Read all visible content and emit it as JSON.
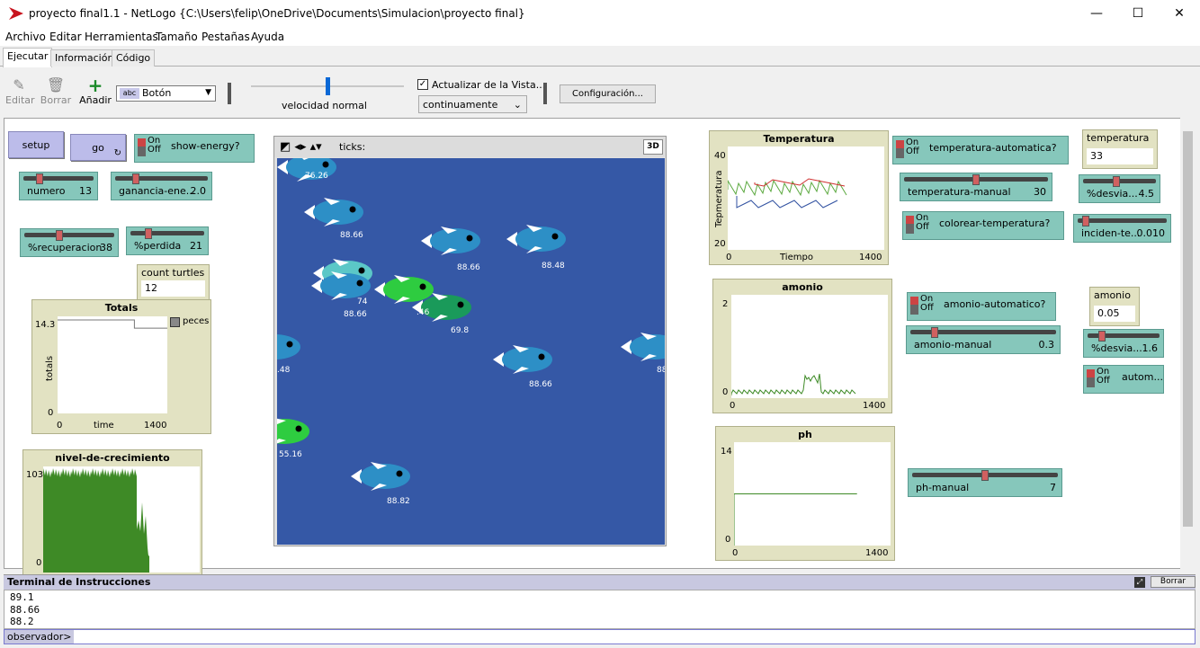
{
  "window": {
    "title": "proyecto final1.1 - NetLogo {C:\\Users\\felip\\OneDrive\\Documents\\Simulacion\\proyecto final}",
    "minimize": "—",
    "maximize": "☐",
    "close": "✕"
  },
  "menu": [
    "Archivo",
    "Editar",
    "Herramientas",
    "Tamaño",
    "Pestañas",
    "Ayuda"
  ],
  "tabs": [
    "Ejecutar",
    "Información",
    "Código"
  ],
  "toolbar": {
    "edit": "Editar",
    "delete": "Borrar",
    "add": "Añadir",
    "widget_type": "Botón",
    "widget_abc": "abc",
    "speed_label": "velocidad normal",
    "update_view_label": "Actualizar de la Vista...",
    "update_mode": "continuamente",
    "settings": "Configuración...",
    "speed_value": 0.5
  },
  "buttons": {
    "setup": "setup",
    "go": "go",
    "go_icon": "↻"
  },
  "switches": {
    "on": "On",
    "off": "Off",
    "show_energy": "show-energy?",
    "temp_auto": "temperatura-automatica?",
    "colorear_temp": "colorear-temperatura?",
    "amonio_auto": "amonio-automatico?",
    "autom": "autom..."
  },
  "sliders": {
    "numero": {
      "name": "numero",
      "value": "13",
      "pos": 0.2
    },
    "ganancia": {
      "name": "ganancia-ene...",
      "value": "2.0",
      "pos": 0.2
    },
    "recuperacion": {
      "name": "%recuperacion",
      "value": "38",
      "pos": 0.38
    },
    "perdida": {
      "name": "%perdida",
      "value": "21",
      "pos": 0.21
    },
    "temp_manual": {
      "name": "temperatura-manual",
      "value": "30",
      "pos": 0.5
    },
    "desvia1": {
      "name": "%desvia...",
      "value": "4.5",
      "pos": 0.45
    },
    "incidente": {
      "name": "inciden-te...",
      "value": "0.010",
      "pos": 0.05
    },
    "amonio_manual": {
      "name": "amonio-manual",
      "value": "0.3",
      "pos": 0.15
    },
    "desvia2": {
      "name": "%desvia...",
      "value": "1.6",
      "pos": 0.16
    },
    "ph_manual": {
      "name": "ph-manual",
      "value": "7",
      "pos": 0.5
    }
  },
  "monitors": {
    "count": {
      "label": "count turtles",
      "value": "12"
    },
    "temperatura": {
      "label": "temperatura",
      "value": "33"
    },
    "amonio": {
      "label": "amonio",
      "value": "0.05"
    }
  },
  "view": {
    "ticks_label": "ticks:",
    "three_d": "3D"
  },
  "fish": [
    {
      "label": "76.26"
    },
    {
      "label": "88.66"
    },
    {
      "label": "88.66"
    },
    {
      "label": "88.48"
    },
    {
      "label": "74"
    },
    {
      "label": "88.66"
    },
    {
      "label": "69.8"
    },
    {
      "label": ".46"
    },
    {
      "label": ".48"
    },
    {
      "label": "88.66"
    },
    {
      "label": "88"
    },
    {
      "label": "55.16"
    },
    {
      "label": "88.82"
    }
  ],
  "chart_data": [
    {
      "type": "line",
      "title": "Totals",
      "xlabel": "time",
      "ylabel": "totals",
      "x_ticks": [
        "0",
        "1400"
      ],
      "y_ticks": [
        "0",
        "14.3"
      ],
      "legend": "peces",
      "series": [
        {
          "name": "peces",
          "x": [
            0,
            70,
            70,
            100
          ],
          "y": [
            14.3,
            14.3,
            13,
            13
          ]
        }
      ]
    },
    {
      "type": "area",
      "title": "nivel-de-crecimiento",
      "x_ticks": [],
      "y_ticks": [
        "0",
        "103"
      ]
    },
    {
      "type": "line",
      "title": "Temperatura",
      "xlabel": "Tiempo",
      "ylabel": "Tepmeratura",
      "x_ticks": [
        "0",
        "1400"
      ],
      "y_ticks": [
        "20",
        "40"
      ]
    },
    {
      "type": "line",
      "title": "amonio",
      "x_ticks": [
        "0",
        "1400"
      ],
      "y_ticks": [
        "0",
        "2"
      ]
    },
    {
      "type": "line",
      "title": "ph",
      "x_ticks": [
        "0",
        "1400"
      ],
      "y_ticks": [
        "0",
        "14"
      ],
      "series": [
        {
          "x": [
            0,
            0,
            1100
          ],
          "y": [
            0,
            7,
            7
          ]
        }
      ]
    }
  ],
  "terminal": {
    "title": "Terminal de Instrucciones",
    "clear": "Borrar",
    "max_icon": "⤢",
    "lines": [
      "89.1",
      "88.66",
      "88.2"
    ],
    "agent": "observador>",
    "command": ""
  },
  "colors": {
    "button": "#bcbcea",
    "switch": "#86c7bb",
    "monitor": "#e2e2c2",
    "world": "#3558a6"
  }
}
